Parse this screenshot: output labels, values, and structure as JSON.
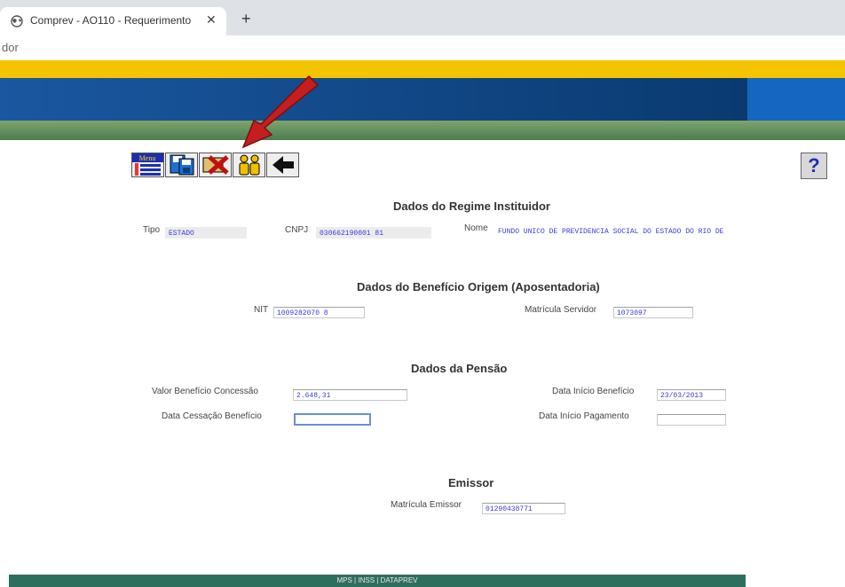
{
  "browser": {
    "tab_title": "Comprev - AO110 - Requerimento",
    "close_glyph": "✕",
    "new_tab_glyph": "+",
    "address_text": "dor"
  },
  "toolbar": {
    "tools": [
      {
        "name": "menu-button",
        "icon": "menu-icon"
      },
      {
        "name": "save-button",
        "icon": "floppy-disk-icon"
      },
      {
        "name": "delete-button",
        "icon": "cancel-x-icon"
      },
      {
        "name": "dependents-button",
        "icon": "persons-icon"
      },
      {
        "name": "back-button",
        "icon": "left-arrow-icon"
      }
    ],
    "menu_label": "Menu",
    "help_label": "?"
  },
  "regime": {
    "title": "Dados do Regime Instituidor",
    "tipo_label": "Tipo",
    "tipo_value": "ESTADO",
    "cnpj_label": "CNPJ",
    "cnpj_value": "030662190001  81",
    "nome_label": "Nome",
    "nome_value": "FUNDO UNICO DE PREVIDENCIA SOCIAL DO ESTADO DO RIO DE"
  },
  "beneficio_origem": {
    "title": "Dados do Benefício Origem (Aposentadoria)",
    "nit_label": "NIT",
    "nit_value": "1009282070  8",
    "matricula_label": "Matrícula Servidor",
    "matricula_value": "1073097"
  },
  "pensao": {
    "title": "Dados da Pensão",
    "valor_label": "Valor Benefício Concessão",
    "valor_value": "2.648,31",
    "data_inicio_label": "Data Início Benefício",
    "data_inicio_value": "23/03/2013",
    "data_cessacao_label": "Data Cessação Benefício",
    "data_cessacao_value": "",
    "data_pagamento_label": "Data Início Pagamento",
    "data_pagamento_value": ""
  },
  "emissor": {
    "title": "Emissor",
    "matricula_label": "Matrícula Emissor",
    "matricula_value": "01290438771"
  },
  "footer": {
    "text": "MPS | INSS | DATAPREV"
  },
  "colors": {
    "yellow": "#f5c400",
    "blue": "#0b3f7a",
    "green": "#4c7b53",
    "field_text": "#3a3adf",
    "arrow": "#c41e1e"
  }
}
